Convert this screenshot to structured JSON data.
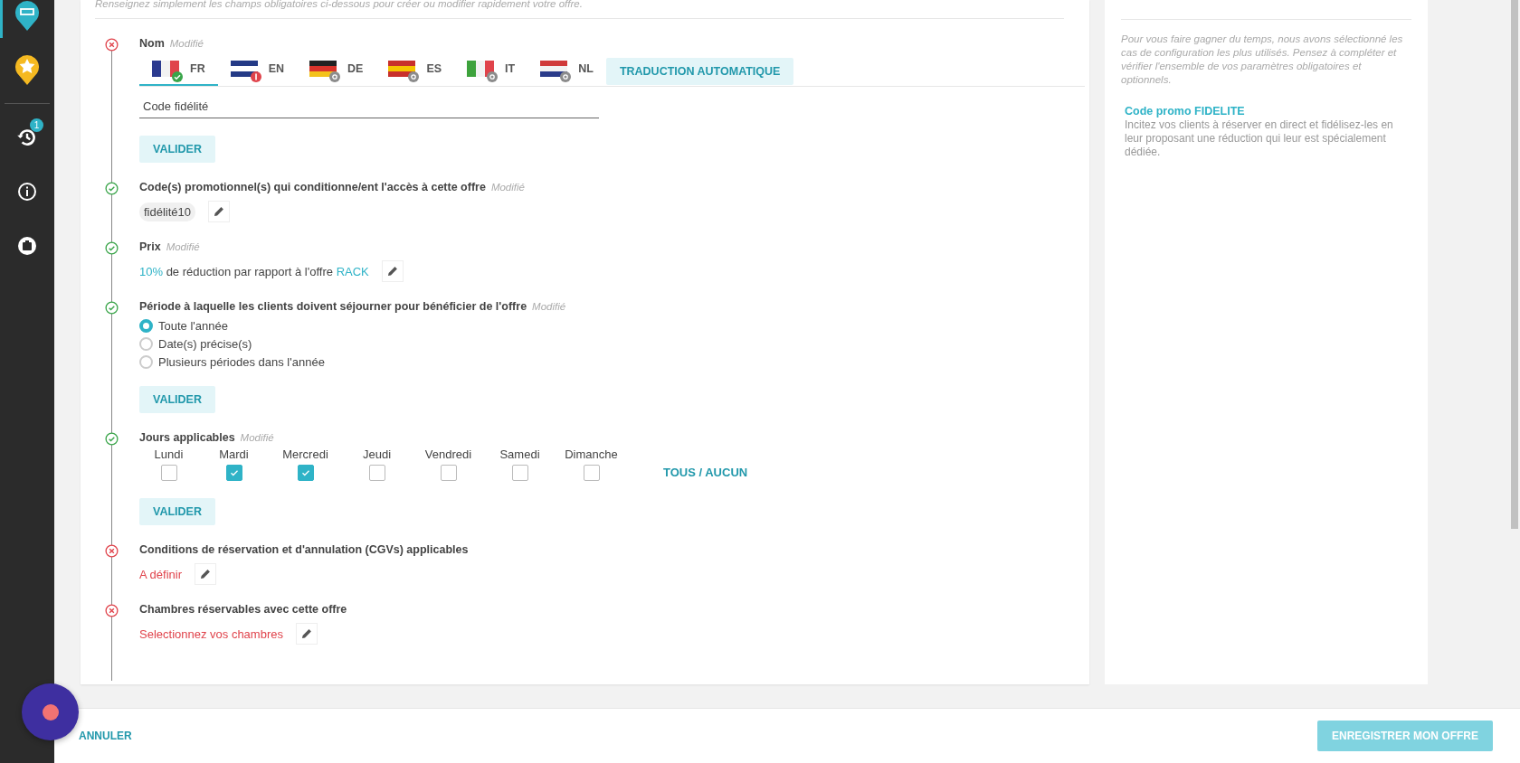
{
  "sidebar": {
    "items": [
      {
        "kind": "hotel",
        "selected": true
      },
      {
        "kind": "star",
        "selected": false
      },
      {
        "kind": "history",
        "selected": false,
        "badge": "1"
      },
      {
        "kind": "info",
        "selected": false
      },
      {
        "kind": "luggage",
        "selected": false
      }
    ]
  },
  "intro": "Renseignez simplement les champs obligatoires ci-dessous pour créer ou modifier rapidement votre offre.",
  "steps": [
    {
      "kind": "name",
      "valid": false,
      "title": "Nom",
      "modified": "Modifié",
      "languages": [
        {
          "code": "FR",
          "kind": "fr",
          "complete": true,
          "error": false,
          "selected": true
        },
        {
          "code": "EN",
          "kind": "gb",
          "complete": false,
          "error": true,
          "selected": false
        },
        {
          "code": "DE",
          "kind": "de",
          "complete": false,
          "error": false,
          "selected": false
        },
        {
          "code": "ES",
          "kind": "es",
          "complete": false,
          "error": false,
          "selected": false
        },
        {
          "code": "IT",
          "kind": "it",
          "complete": false,
          "error": false,
          "selected": false
        },
        {
          "code": "NL",
          "kind": "nl",
          "complete": false,
          "error": false,
          "selected": false
        }
      ],
      "auto_translate": "TRADUCTION AUTOMATIQUE",
      "value": "Code fidélité",
      "button": "VALIDER"
    },
    {
      "kind": "tag",
      "valid": true,
      "title": "Code(s) promotionnel(s) qui conditionne/ent l'accès à cette offre",
      "modified": "Modifié",
      "tag": "fidélité10"
    },
    {
      "kind": "price",
      "valid": true,
      "title": "Prix",
      "modified": "Modifié",
      "percent": "10%",
      "text": "de réduction par rapport à l'offre",
      "link": "RACK"
    },
    {
      "kind": "radio",
      "valid": true,
      "title": "Période à laquelle les clients doivent séjourner pour bénéficier de l'offre",
      "modified": "Modifié",
      "options": [
        {
          "label": "Toute l'année",
          "selected": true
        },
        {
          "label": "Date(s) précise(s)",
          "selected": false
        },
        {
          "label": "Plusieurs périodes dans l'année",
          "selected": false
        }
      ],
      "button": "VALIDER"
    },
    {
      "kind": "days",
      "valid": true,
      "title": "Jours applicables",
      "modified": "Modifié",
      "days": [
        {
          "label": "Lundi",
          "checked": false
        },
        {
          "label": "Mardi",
          "checked": true
        },
        {
          "label": "Mercredi",
          "checked": true
        },
        {
          "label": "Jeudi",
          "checked": false
        },
        {
          "label": "Vendredi",
          "checked": false
        },
        {
          "label": "Samedi",
          "checked": false
        },
        {
          "label": "Dimanche",
          "checked": false
        }
      ],
      "toggle": "TOUS / AUCUN",
      "button": "VALIDER"
    },
    {
      "kind": "action",
      "valid": false,
      "title": "Conditions de réservation et d'annulation (CGVs) applicables",
      "value": "A définir"
    },
    {
      "kind": "action",
      "valid": false,
      "title": "Chambres réservables avec cette offre",
      "value": "Selectionnez vos chambres"
    }
  ],
  "aside": {
    "note": "Pour vous faire gagner du temps, nous avons sélectionné les cas de configuration les plus utilisés. Pensez à compléter et vérifier l'ensemble de vos paramètres obligatoires et optionnels.",
    "tip_title": "Code promo FIDELITE",
    "tip_text": "Incitez vos clients à réserver en direct et fidélisez-les en leur proposant une réduction qui leur est spécialement dédiée."
  },
  "footer": {
    "cancel": "ANNULER",
    "save": "ENREGISTRER MON OFFRE",
    "save_disabled": true
  }
}
